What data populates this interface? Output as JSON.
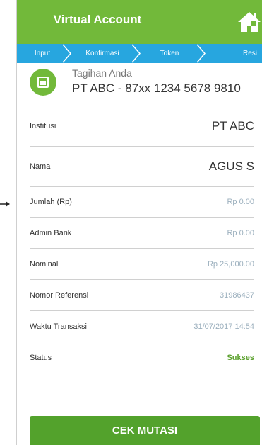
{
  "header": {
    "title": "Virtual Account",
    "home_icon": "home-icon"
  },
  "steps": [
    {
      "label": "Input"
    },
    {
      "label": "Konfirmasi"
    },
    {
      "label": "Token"
    },
    {
      "label": "Resi"
    }
  ],
  "bill": {
    "label": "Tagihan Anda",
    "value": "PT ABC - 87xx 1234 5678 9810",
    "icon": "receipt-icon"
  },
  "rows": [
    {
      "label": "Institusi",
      "value": "PT ABC"
    },
    {
      "label": "Nama",
      "value": "AGUS S"
    },
    {
      "label": "Jumlah (Rp)",
      "value": "Rp 0.00"
    },
    {
      "label": "Admin Bank",
      "value": "Rp 0.00"
    },
    {
      "label": "Nominal",
      "value": "Rp 25,000.00"
    },
    {
      "label": "Nomor Referensi",
      "value": "31986437"
    },
    {
      "label": "Waktu Transaksi",
      "value": "31/07/2017 14:54"
    },
    {
      "label": "Status",
      "value": "Sukses"
    }
  ],
  "cta": {
    "label": "CEK MUTASI"
  },
  "colors": {
    "header": "#72b93a",
    "steps": "#27a6df",
    "cta": "#53a22c",
    "status_ok": "#5aa02c"
  }
}
